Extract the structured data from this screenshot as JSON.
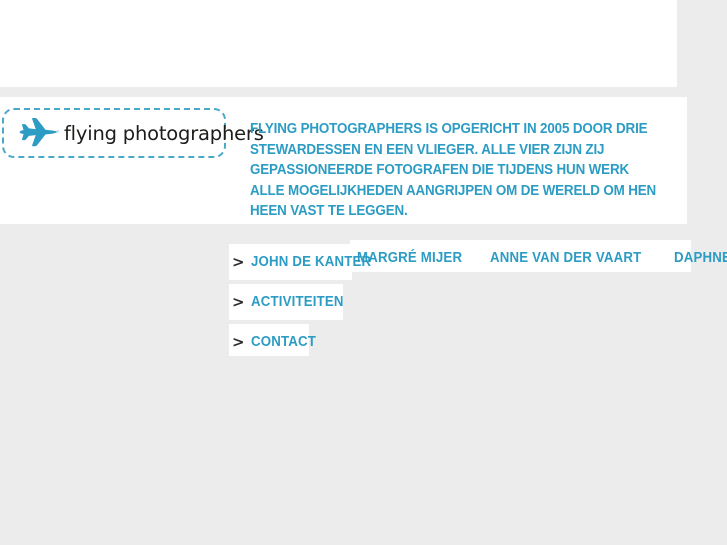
{
  "site": {
    "logo": {
      "icon": "airplane-icon",
      "text": "flying photographers",
      "accent_color": "#2c9cc4",
      "border_style": "dashed"
    },
    "intro_paragraph": "Flying photographers is opgericht in 2005 door drie stewardessen en een vlieger. Alle vier zijn zij gepassioneerde fotografen die tijdens hun werk alle mogelijkheden aangrijpen om de wereld om hen heen vast te leggen.",
    "background_color": "#ececec",
    "panel_color": "#ffffff",
    "link_color": "#2c9cc4",
    "chevron_color": "#2b2b2b"
  },
  "nav": {
    "marker": ">",
    "items": [
      {
        "label": "John de Kanter"
      },
      {
        "label": "Activiteiten"
      },
      {
        "label": "Contact"
      }
    ],
    "submenu": [
      {
        "label": "Margré Mijer"
      },
      {
        "label": "Anne van der Vaart"
      },
      {
        "label": "Daphne Vermeulen"
      }
    ]
  }
}
